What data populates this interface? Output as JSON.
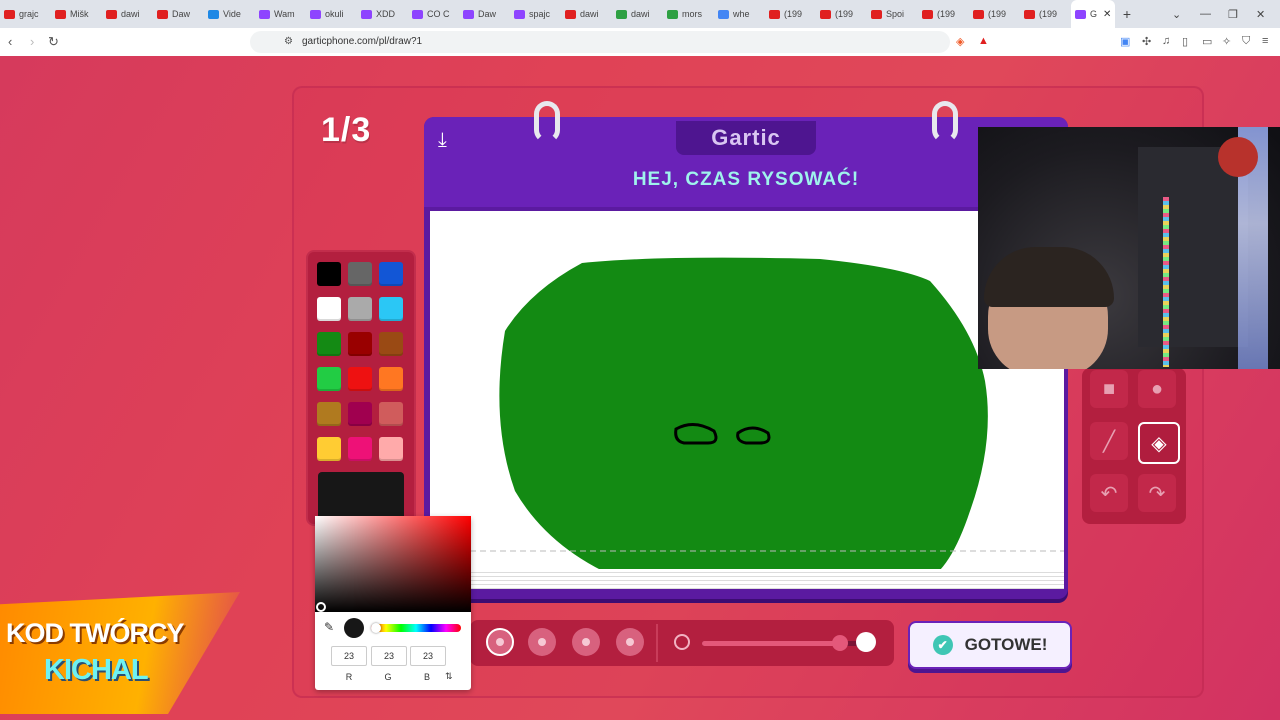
{
  "browser": {
    "tabs": [
      {
        "label": "grajc",
        "icon_color": "#e02020"
      },
      {
        "label": "Mišk",
        "icon_color": "#e02020"
      },
      {
        "label": "dawi",
        "icon_color": "#e02020"
      },
      {
        "label": "Daw",
        "icon_color": "#e02020"
      },
      {
        "label": "Vide",
        "icon_color": "#1e88e5"
      },
      {
        "label": "Wam",
        "icon_color": "#8e44ff"
      },
      {
        "label": "okuli",
        "icon_color": "#8e44ff"
      },
      {
        "label": "XDD",
        "icon_color": "#8e44ff"
      },
      {
        "label": "CO C",
        "icon_color": "#8e44ff"
      },
      {
        "label": "Daw",
        "icon_color": "#8e44ff"
      },
      {
        "label": "spajc",
        "icon_color": "#8e44ff"
      },
      {
        "label": "dawi",
        "icon_color": "#e02020"
      },
      {
        "label": "dawi",
        "icon_color": "#2ea043"
      },
      {
        "label": "mors",
        "icon_color": "#2ea043"
      },
      {
        "label": "whe",
        "icon_color": "#4285f4"
      },
      {
        "label": "(199",
        "icon_color": "#e02020"
      },
      {
        "label": "(199",
        "icon_color": "#e02020"
      },
      {
        "label": "Spoi",
        "icon_color": "#e02020"
      },
      {
        "label": "(199",
        "icon_color": "#e02020"
      },
      {
        "label": "(199",
        "icon_color": "#e02020"
      },
      {
        "label": "(199",
        "icon_color": "#e02020"
      }
    ],
    "active_tab_label": "G",
    "url": "garticphone.com/pl/draw?1"
  },
  "game": {
    "round": "1/3",
    "logo": "Gartic",
    "prompt": "HEJ, CZAS RYSOWAĆ!",
    "palette": [
      "#000000",
      "#666666",
      "#1256d6",
      "#ffffff",
      "#aaaaaa",
      "#2bc7f5",
      "#148a14",
      "#990000",
      "#9a4a14",
      "#22cc44",
      "#ee1111",
      "#ff7722",
      "#b07a1f",
      "#a0004f",
      "#d05c5c",
      "#ffcc33",
      "#ee1177",
      "#ffaaaa"
    ],
    "current_color": "#171717",
    "done_label": "GOTOWE!",
    "brush_size_fraction": 0.86
  },
  "picker": {
    "r": "23",
    "g": "23",
    "b": "23",
    "r_label": "R",
    "g_label": "G",
    "b_label": "B"
  },
  "promo": {
    "line1": "KOD TWÓRCY",
    "line2": "KICHAL"
  }
}
